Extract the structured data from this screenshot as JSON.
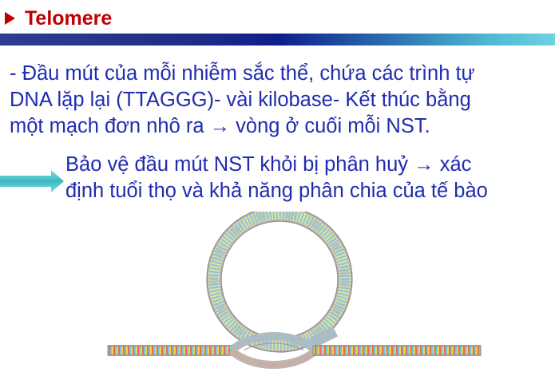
{
  "title": "Telomere",
  "paragraph": [
    "- Đầu mút của mỗi nhiễm sắc thể, chứa các trình tự",
    "DNA lặp lại (TTAGGG)- vài kilobase- Kết thúc bằng",
    "một mạch đơn nhô ra →  vòng ở cuối mỗi NST."
  ],
  "conclusion": [
    "Bảo vệ đầu mút NST khỏi bị phân huỷ → xác",
    "định tuổi thọ và khả năng phân chia của tế bào"
  ],
  "colors": {
    "title": "#c00000",
    "text": "#1f2cb0",
    "arrow": "#4cc3c9"
  },
  "icons": {
    "title_bullet": "triangle-right-icon",
    "side_arrow": "arrow-right-icon"
  }
}
